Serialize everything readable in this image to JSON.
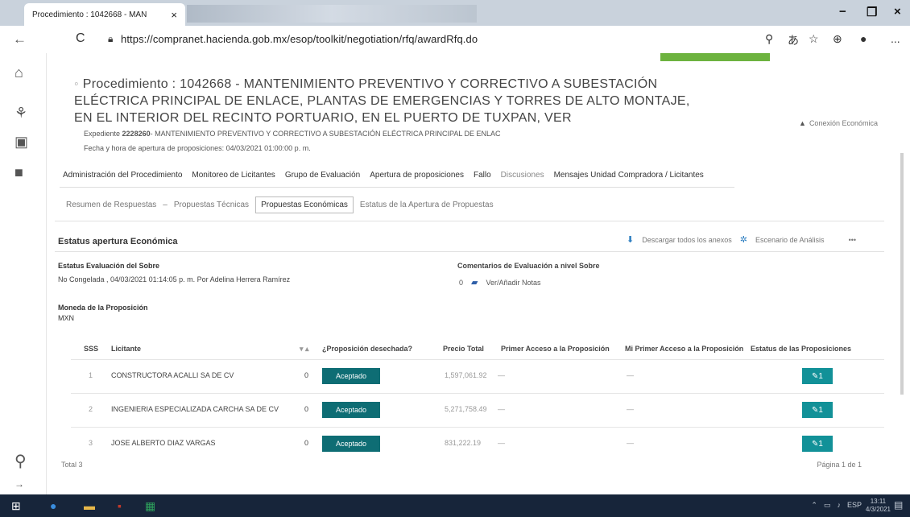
{
  "browser": {
    "tab_title": "Procedimiento : 1042668 - MAN",
    "tab_close": "×",
    "url": "https://compranet.hacienda.gob.mx/esop/toolkit/negotiation/rfq/awardRfq.do",
    "back_glyph": "←",
    "reload_glyph": "C",
    "lock_glyph": "🔒︎",
    "win_minimize": "−",
    "win_close": "×",
    "more_glyph": "..."
  },
  "page": {
    "title": "Procedimiento : 1042668 - MANTENIMIENTO PREVENTIVO Y CORRECTIVO A SUBESTACIÓN ELÉCTRICA PRINCIPAL DE ENLACE, PLANTAS DE EMERGENCIAS Y TORRES DE ALTO MONTAJE, EN EL INTERIOR DEL RECINTO PORTUARIO, EN EL PUERTO DE TUXPAN, VER",
    "conexion": "Conexión Económica",
    "expediente_prefix": "Expediente ",
    "expediente_number": "2228260",
    "expediente_text": "- MANTENIMIENTO PREVENTIVO Y CORRECTIVO A SUBESTACIÓN ELÉCTRICA PRINCIPAL DE ENLAC",
    "fecha": "Fecha y hora de apertura de proposiciones: 04/03/2021 01:00:00 p. m."
  },
  "main_tabs": [
    "Administración del Procedimiento",
    "Monitoreo de Licitantes",
    "Grupo de Evaluación",
    "Apertura de proposiciones",
    "Fallo",
    "Discusiones",
    "Mensajes Unidad Compradora / Licitantes"
  ],
  "sub_tabs": [
    "Resumen de Respuestas",
    "Propuestas Técnicas",
    "Propuestas Económicas",
    "Estatus de la Apertura de Propuestas"
  ],
  "section": {
    "title": "Estatus apertura Económica",
    "download": "Descargar todos los anexos",
    "escenario": "Escenario de Análisis",
    "more": "•••"
  },
  "evaluacion": {
    "label": "Estatus Evaluación del Sobre",
    "value": "No Congelada , 04/03/2021 01:14:05 p. m. Por Adelina Herrera Ramírez",
    "comentarios_label": "Comentarios de Evaluación a nivel Sobre",
    "comentarios_count": "0",
    "notas_link": "Ver/Añadir Notas"
  },
  "moneda": {
    "label": "Moneda de la Proposición",
    "value": "MXN"
  },
  "table": {
    "headers": {
      "sss": "SSS",
      "licitante": "Licitante",
      "desechada": "¿Proposición desechada?",
      "precio": "Precio Total",
      "primer_acceso": "Primer Acceso a la Proposición",
      "mi_primer": "Mi Primer Acceso a la Proposición",
      "estatus": "Estatus de las Proposiciones"
    },
    "rows": [
      {
        "sss": "1",
        "licitante": "CONSTRUCTORA ACALLI SA DE CV",
        "count": "0",
        "status": "Aceptado",
        "precio": "1,597,061.92",
        "primer": "—",
        "mi_primer": "—",
        "estatus_btn": "✎1"
      },
      {
        "sss": "2",
        "licitante": "INGENIERIA ESPECIALIZADA CARCHA SA DE CV",
        "count": "0",
        "status": "Aceptado",
        "precio": "5,271,758.49",
        "primer": "—",
        "mi_primer": "—",
        "estatus_btn": "✎1"
      },
      {
        "sss": "3",
        "licitante": "JOSE ALBERTO DIAZ VARGAS",
        "count": "0",
        "status": "Aceptado",
        "precio": "831,222.19",
        "primer": "—",
        "mi_primer": "—",
        "estatus_btn": "✎1"
      }
    ],
    "total": "Total 3",
    "pagina": "Página 1 de 1"
  },
  "taskbar": {
    "lang": "ESP",
    "time": "13:11",
    "date": "4/3/2021"
  },
  "colors": {
    "accept": "#0e6d74",
    "estatus": "#129198",
    "taskbar": "#17253a",
    "green": "#6db33f"
  }
}
